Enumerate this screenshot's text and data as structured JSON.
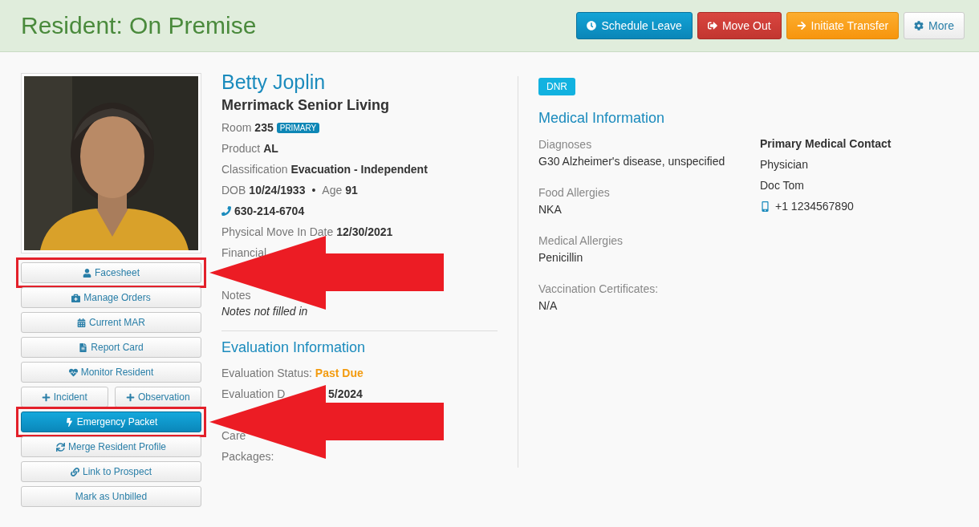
{
  "header": {
    "title": "Resident: On Premise",
    "actions": [
      {
        "label": "Schedule Leave",
        "kind": "info"
      },
      {
        "label": "Move Out",
        "kind": "danger"
      },
      {
        "label": "Initiate Transfer",
        "kind": "warning"
      },
      {
        "label": "More",
        "kind": "default"
      }
    ]
  },
  "sidebar": {
    "buttons": [
      {
        "label": "Facesheet",
        "kind": "default",
        "highlighted": true
      },
      {
        "label": "Manage Orders",
        "kind": "default",
        "highlighted": false
      },
      {
        "label": "Current MAR",
        "kind": "default",
        "highlighted": false
      },
      {
        "label": "Report Card",
        "kind": "default",
        "highlighted": false
      },
      {
        "label": "Monitor Resident",
        "kind": "default",
        "highlighted": false
      },
      {
        "label": "Incident",
        "kind": "half",
        "highlighted": false
      },
      {
        "label": "Observation",
        "kind": "half",
        "highlighted": false
      },
      {
        "label": "Emergency Packet",
        "kind": "primary",
        "highlighted": true
      },
      {
        "label": "Merge Resident Profile",
        "kind": "default",
        "highlighted": false
      },
      {
        "label": "Link to Prospect",
        "kind": "default",
        "highlighted": false
      },
      {
        "label": "Mark as Unbilled",
        "kind": "default",
        "highlighted": false
      }
    ]
  },
  "resident": {
    "name": "Betty Joplin",
    "community": "Merrimack Senior Living",
    "rows": [
      {
        "kind": "field",
        "label": "Room",
        "value": "235",
        "badge": "PRIMARY"
      },
      {
        "kind": "field",
        "label": "Product",
        "value": "AL"
      },
      {
        "kind": "field",
        "label": "Classification",
        "value": "Evacuation - Independent"
      },
      {
        "kind": "dob",
        "label": "DOB",
        "value": "10/24/1933",
        "separator": "•",
        "age_label": "Age",
        "age": "91"
      },
      {
        "kind": "phone",
        "value": "630-214-6704"
      },
      {
        "kind": "field",
        "label": "Physical Move In Date",
        "value": "12/30/2021"
      },
      {
        "kind": "covered",
        "label": "Financial"
      },
      {
        "kind": "blank"
      },
      {
        "kind": "stacked",
        "label": "Notes",
        "value": "Notes not filled in"
      }
    ],
    "evaluation": {
      "title": "Evaluation Information",
      "rows": [
        {
          "kind": "field",
          "label": "Evaluation Status:",
          "value": "Past Due",
          "warning": true
        },
        {
          "kind": "covered",
          "label": "Evaluation D",
          "value": "5/2024"
        },
        {
          "kind": "blank"
        },
        {
          "kind": "covered",
          "label": "Care"
        },
        {
          "kind": "field",
          "label": "Packages:"
        }
      ]
    }
  },
  "medical": {
    "badge": "DNR",
    "title": "Medical Information",
    "items": [
      {
        "label": "Diagnoses",
        "value": "G30 Alzheimer's disease, unspecified"
      },
      {
        "label": "Food Allergies",
        "value": "NKA"
      },
      {
        "label": "Medical Allergies",
        "value": "Penicillin"
      },
      {
        "label": "Vaccination Certificates:",
        "value": "N/A"
      }
    ],
    "contact": {
      "title": "Primary Medical Contact",
      "role": "Physician",
      "name": "Doc Tom",
      "phone": "+1 1234567890"
    }
  }
}
